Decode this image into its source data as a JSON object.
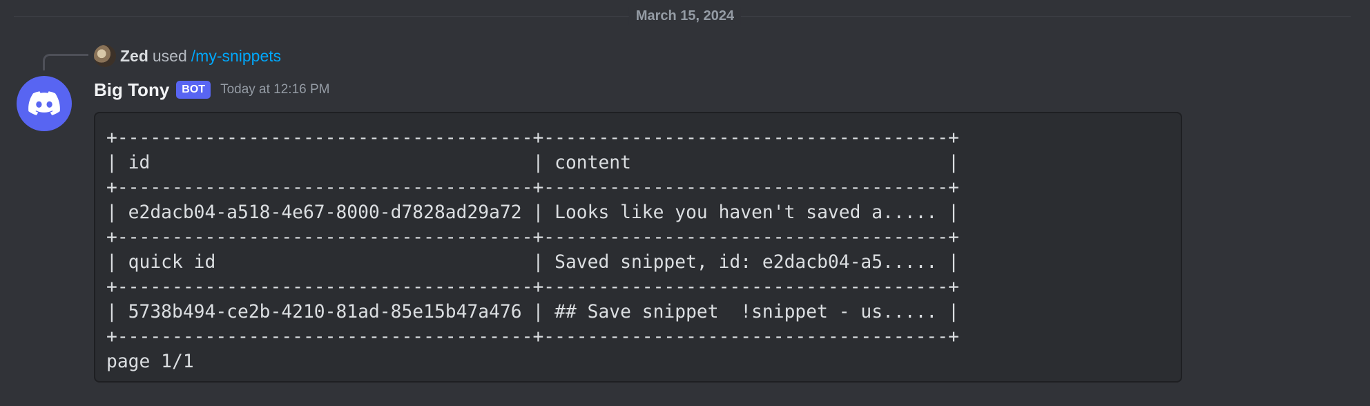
{
  "divider": {
    "date": "March 15, 2024"
  },
  "reply": {
    "user": "Zed",
    "verb": "used",
    "command": "/my-snippets"
  },
  "message": {
    "author": "Big Tony",
    "tag": "BOT",
    "timestamp": "Today at 12:16 PM",
    "avatar_color": "#5865f2",
    "code_lines": [
      "+--------------------------------------+-------------------------------------+",
      "| id                                   | content                             |",
      "+--------------------------------------+-------------------------------------+",
      "| e2dacb04-a518-4e67-8000-d7828ad29a72 | Looks like you haven't saved a..... |",
      "+--------------------------------------+-------------------------------------+",
      "| quick id                             | Saved snippet, id: e2dacb04-a5..... |",
      "+--------------------------------------+-------------------------------------+",
      "| 5738b494-ce2b-4210-81ad-85e15b47a476 | ## Save snippet  !snippet - us..... |",
      "+--------------------------------------+-------------------------------------+",
      "page 1/1"
    ]
  },
  "colors": {
    "background": "#313338",
    "code_background": "#2b2d31",
    "link": "#00a8fc",
    "bot_tag": "#5865f2"
  },
  "icons": {
    "bot_avatar": "discord-logo-icon"
  }
}
